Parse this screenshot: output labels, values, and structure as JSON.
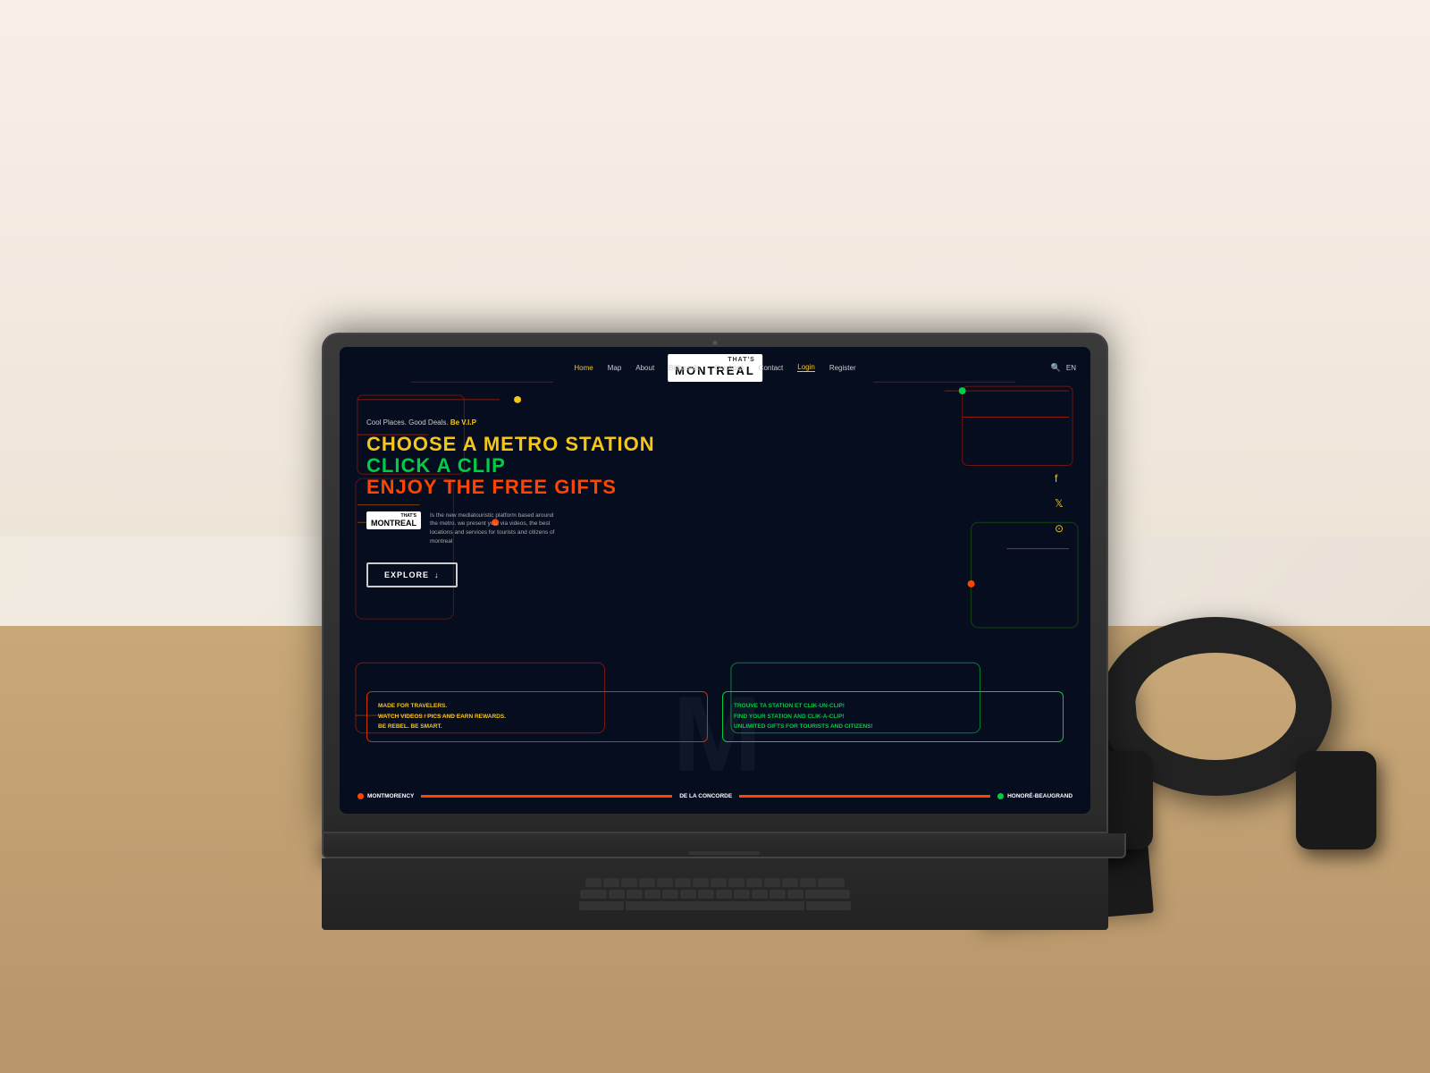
{
  "scene": {
    "background": "#f0ebe3"
  },
  "website": {
    "bg_color": "#060d1f",
    "logo": {
      "thats": "THAT'S",
      "montreal": "MONTREAL"
    },
    "nav": {
      "links": [
        "Home",
        "Map",
        "About",
        "Billboards",
        "Our Apps",
        "Contact",
        "Login",
        "Register"
      ],
      "active": "Home",
      "login": "Login",
      "register": "Register",
      "lang": "EN"
    },
    "hero": {
      "tagline": "Cool Places. Good Deals.",
      "tagline_vip": "Be V.I.P",
      "headline1": "CHOOSE A METRO STATION",
      "headline2": "CLICK A CLIP",
      "headline3": "ENJOY THE FREE GIFTS",
      "description": "Is the new mediatouristic platform based around the metro. we present you, via videos, the best locations and services for tourists and citizens of montreal",
      "explore_btn": "EXPLORE"
    },
    "social": {
      "icons": [
        "facebook",
        "twitter",
        "instagram"
      ]
    },
    "cards": {
      "left": {
        "line1": "MADE FOR TRAVELERS.",
        "line2": "WATCH VIDEOS / PICS AND EARN REWARDS.",
        "line3": "BE REBEL. BE SMART."
      },
      "right": {
        "line1": "TROUVE TA STATION ET CLIK-UN-CLIP!",
        "line2": "FIND YOUR STATION AND CLIK-A-CLIP!",
        "line3": "UNLIMITED GIFTS FOR TOURISTS AND CITIZENS!"
      }
    },
    "metro": {
      "stations": [
        "MONTMORENCY",
        "DE LA CONCORDE",
        "HONORÉ-BEAUGRAND"
      ],
      "dot_colors": [
        "#ff4400",
        "#ff4400",
        "#00cc44"
      ]
    }
  }
}
